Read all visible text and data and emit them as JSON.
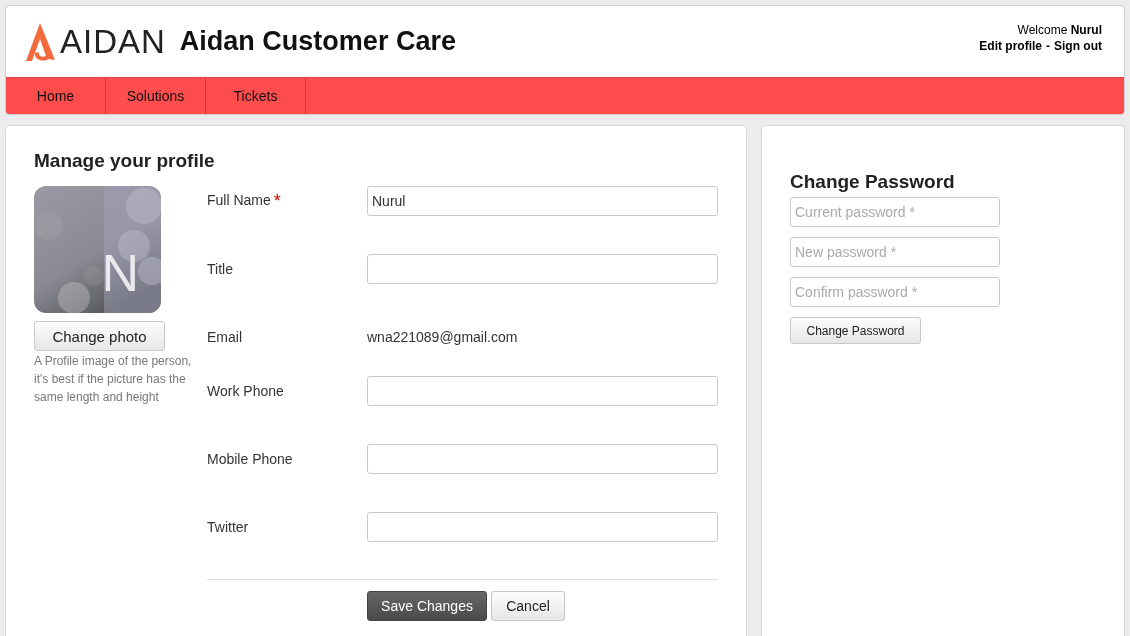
{
  "header": {
    "logo_text": "AIDAN",
    "title": "Aidan Customer Care",
    "welcome": "Welcome **Nurul**",
    "links": [
      "Edit profile",
      "Sign out"
    ],
    "link_separator": "-"
  },
  "nav": [
    {
      "label": "Home"
    },
    {
      "label": "Solutions"
    },
    {
      "label": "Tickets"
    }
  ],
  "profile": {
    "heading": "Manage your profile",
    "avatar": {
      "kind": "picture",
      "initial": "N"
    },
    "change_photo": "Change photo",
    "hint": "A Profile image of the person, it's best if the picture has the same length and height",
    "fields": [
      {
        "kind": "input",
        "label": "Full Name",
        "required": true,
        "value": "Nurul"
      },
      {
        "kind": "input",
        "label": "Title",
        "required": false
      },
      {
        "kind": "text",
        "label": "Email",
        "required": false,
        "value": "wna221089@gmail.com"
      },
      {
        "kind": "input",
        "label": "Work Phone",
        "required": false
      },
      {
        "kind": "input",
        "label": "Mobile Phone",
        "required": false
      },
      {
        "kind": "input",
        "label": "Twitter",
        "required": false
      }
    ],
    "required_mark": "*",
    "buttons": [
      {
        "label": "Save Changes",
        "primary": true
      },
      {
        "label": "Cancel",
        "primary": false
      }
    ]
  },
  "password": {
    "heading": "Change Password",
    "fields": [
      {
        "placeholder": "Current password *"
      },
      {
        "placeholder": "New password *"
      },
      {
        "placeholder": "Confirm password *"
      }
    ],
    "button": "Change Password"
  }
}
